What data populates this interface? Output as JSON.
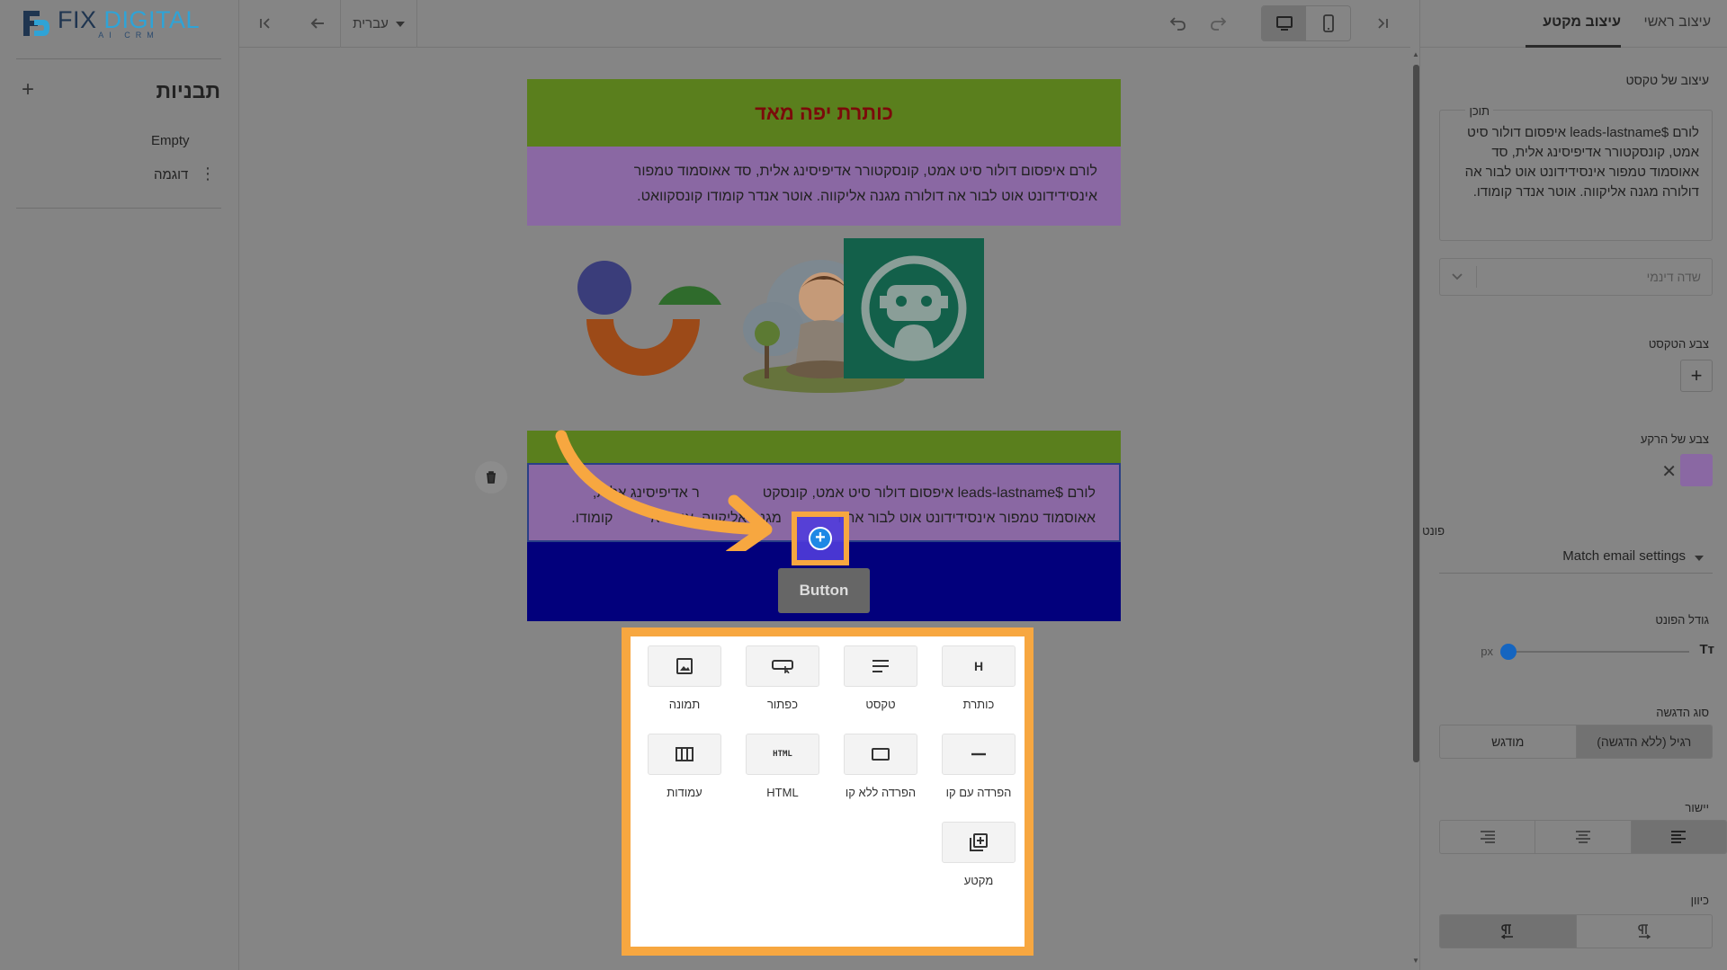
{
  "brand": {
    "name_part1": "FIX",
    "name_part2": "DIGITAL",
    "tagline": "AI CRM",
    "accent": "#2fa3d6"
  },
  "sidebar": {
    "title": "תבניות",
    "add_icon": "plus-icon",
    "items": [
      {
        "label": "Empty"
      },
      {
        "label": "דוגמה"
      }
    ]
  },
  "toolbar": {
    "language": "עברית",
    "icons": [
      "collapse-left-icon",
      "back-arrow-icon",
      "undo-icon",
      "redo-icon",
      "desktop-icon",
      "mobile-icon",
      "collapse-right-icon"
    ],
    "active_device": "desktop"
  },
  "email": {
    "heading": "כותרת יפה מאד",
    "paragraph1_line1": "לורם איפסום דולור סיט אמט, קונסקטורר אדיפיסינג אלית, סד אאוסמוד טמפור",
    "paragraph1_line2": "אינסידידונט אוט לבור אה דולורה מגנה אליקווה. אוטר אנדר קומודו קונסקוואט.",
    "paragraph2_line1": "לורם $leads-lastname איפסום דולור סיט אמט, קונסקט",
    "paragraph2_line1b": "ר אדיפיסינג אלית,",
    "paragraph2_line2": "אאוסמוד טמפור אינסידידונט אוט לבור אה ד",
    "paragraph2_line2b": "מגנה אליקווה. אוטר א",
    "paragraph2_line2c": "קומודו.",
    "button_label": "Button",
    "colors": {
      "heading_bg": "#5a7f1d",
      "heading_text": "#7b0a0a",
      "para_bg": "#8a68a3",
      "button_row_bg": "#02007c"
    }
  },
  "block_picker": {
    "blocks": [
      {
        "label": "כותרת",
        "icon": "heading-icon"
      },
      {
        "label": "טקסט",
        "icon": "text-icon"
      },
      {
        "label": "כפתור",
        "icon": "button-icon"
      },
      {
        "label": "תמונה",
        "icon": "image-icon"
      },
      {
        "label": "הפרדה עם קו",
        "icon": "divider-line-icon"
      },
      {
        "label": "הפרדה ללא קו",
        "icon": "spacer-icon"
      },
      {
        "label": "HTML",
        "icon": "html-icon"
      },
      {
        "label": "עמודות",
        "icon": "columns-icon"
      },
      {
        "label": "מקטע",
        "icon": "section-icon"
      }
    ],
    "highlight_color": "#f7a740"
  },
  "panel": {
    "tabs": [
      {
        "label": "עיצוב ראשי"
      },
      {
        "label": "עיצוב מקטע"
      }
    ],
    "active_tab": "עיצוב מקטע",
    "section_title": "עיצוב של טקסט",
    "content_label": "תוכן",
    "content_text": "לורם  $leads-lastname איפסום דולור סיט אמט, קונסקטורר אדיפיסינג אלית, סד אאוסמוד טמפור אינסידידונט אוט לבור אה דולורה מגנה אליקווה. אוטר אנדר קומודו.",
    "dynamic_field_placeholder": "שדה דינמי",
    "text_color_label": "צבע הטקסט",
    "bg_color_label": "צבע של הרקע",
    "bg_color": "#8a68a3",
    "font_label": "פונט",
    "font_value": "Match email settings",
    "font_size_label": "גודל הפונט",
    "font_size_unit": "px",
    "font_size_icon": "Tт",
    "emphasis_label": "סוג הדגשה",
    "emphasis_options": [
      {
        "label": "רגיל (ללא הדגשה)"
      },
      {
        "label": "מודגש"
      }
    ],
    "emphasis_selected": "רגיל (ללא הדגשה)",
    "align_label": "יישור",
    "direction_label": "כיוון"
  }
}
